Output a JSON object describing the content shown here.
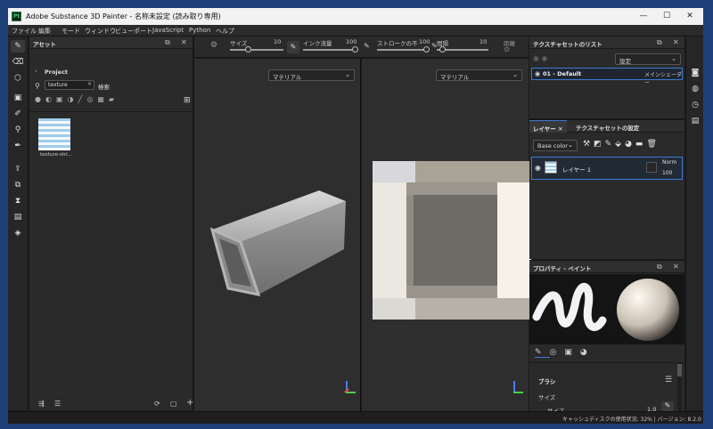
{
  "window": {
    "logo": "Pt",
    "title": "Adobe Substance 3D Painter - 名称未設定 (読み取り専用)",
    "controls": {
      "minimize": "—",
      "maximize": "☐",
      "close": "✕"
    }
  },
  "menu": [
    "ファイル",
    "編集",
    "モード",
    "ウィンドウ",
    "ビューポート",
    "JavaScript",
    "Python",
    "ヘルプ"
  ],
  "toolbar_tools": [
    "brush-tool",
    "eraser-tool",
    "projection-tool",
    "geometry-mask-tool",
    "smudge-tool",
    "clone-tool",
    "picker-tool",
    "bake-tool",
    "export-tool",
    "history-tool",
    "shelf-tool",
    "display-tool"
  ],
  "assets": {
    "title": "アセット",
    "breadcrumb": "Project",
    "search_value": "texture",
    "search_label": "検索",
    "thumb_label": "texture-stri..."
  },
  "viewport_toolbar": {
    "size_label": "サイズ",
    "size_value": "10",
    "flow_label": "インク流量",
    "flow_value": "100",
    "stroke_label": "ストロークの不",
    "stroke_value": "100",
    "spacing_label": "間隔",
    "spacing_value": "10",
    "reset_label": "距離"
  },
  "viewport3d": {
    "material": "マテリアル"
  },
  "viewport2d": {
    "material": "マテリアル"
  },
  "texture_sets": {
    "title": "テクスチャセットのリスト",
    "settings": "設定",
    "item_name": "01 - Default",
    "item_shader": "メインシェーダー"
  },
  "layers": {
    "tab_layers": "レイヤー",
    "tab_settings": "テクスチャセットの設定",
    "channel": "Base color",
    "layer_name": "レイヤー 1",
    "blend": "Norm",
    "opacity": "100"
  },
  "properties": {
    "title": "プロパティ - ペイント",
    "section": "ブラシ",
    "size_header": "サイズ",
    "size_label": "サイズ",
    "size_value": "1.0"
  },
  "status": {
    "text": "キャッシュディスクの使用状況: 32% | バージョン: 8.2.0"
  },
  "colors": {
    "title_bg": "#f2f2f2",
    "panel_bg": "#2a2a2a",
    "accent": "#3a7bd5"
  }
}
